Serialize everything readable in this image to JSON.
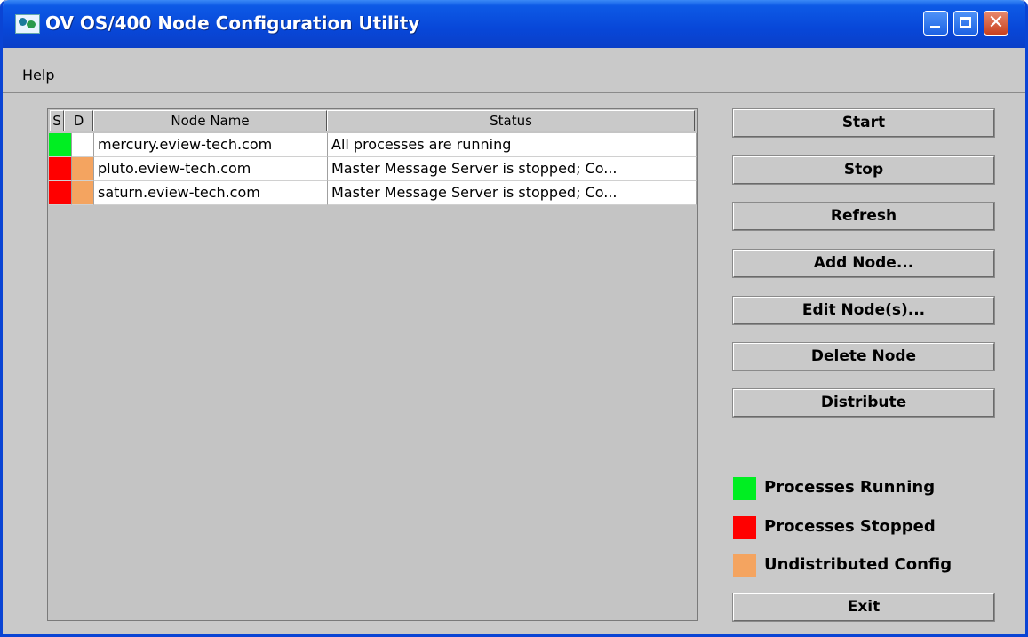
{
  "window": {
    "title": "OV OS/400 Node Configuration Utility"
  },
  "titlebar_buttons": {
    "minimize_icon": "minimize-icon",
    "maximize_icon": "maximize-icon",
    "close_glyph": "✕"
  },
  "menu": {
    "help_label": "Help"
  },
  "table": {
    "headers": {
      "s": "S",
      "d": "D",
      "node_name": "Node Name",
      "status": "Status"
    },
    "rows": [
      {
        "s_color": "#00ee22",
        "d_color": "#ffffff",
        "node_name": "mercury.eview-tech.com",
        "status": "All processes are running"
      },
      {
        "s_color": "#ff0000",
        "d_color": "#f4a460",
        "node_name": "pluto.eview-tech.com",
        "status": "Master Message Server is stopped; Co..."
      },
      {
        "s_color": "#ff0000",
        "d_color": "#f4a460",
        "node_name": "saturn.eview-tech.com",
        "status": "Master Message Server is stopped; Co..."
      }
    ]
  },
  "buttons": {
    "start": "Start",
    "stop": "Stop",
    "refresh": "Refresh",
    "add_node": "Add Node...",
    "edit_nodes": "Edit Node(s)...",
    "delete_node": "Delete Node",
    "distribute": "Distribute",
    "exit": "Exit"
  },
  "legend": {
    "running": {
      "label": "Processes Running",
      "color": "#00ee22"
    },
    "stopped": {
      "label": "Processes Stopped",
      "color": "#ff0000"
    },
    "undistributed": {
      "label": "Undistributed Config",
      "color": "#f4a460"
    }
  }
}
